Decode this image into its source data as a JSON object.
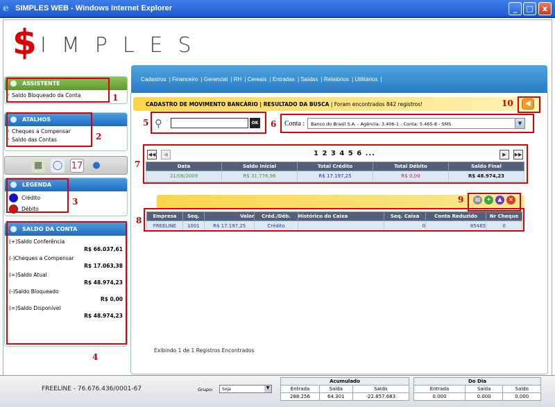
{
  "window": {
    "title": "SIMPLES WEB - Windows Internet Explorer",
    "min": "_",
    "max": "□",
    "close": "x"
  },
  "logo": {
    "dollar": "$",
    "rest": "IMPLES"
  },
  "menu": {
    "items": [
      "Cadastros",
      "Financeiro",
      "Gerencial",
      "RH",
      "Cereais",
      "Entradas",
      "Saídas",
      "Relatórios",
      "Utilitários"
    ]
  },
  "assistente": {
    "title": "ASSISTENTE",
    "items": [
      "Saldo Bloqueado da Conta"
    ]
  },
  "atalhos": {
    "title": "ATALHOS",
    "items": [
      "Cheques a Compensar",
      "Saldo das Contas"
    ]
  },
  "legenda": {
    "title": "LEGENDA",
    "items": [
      {
        "label": "Crédito",
        "color": "#0a10d8"
      },
      {
        "label": "Débito",
        "color": "#d81010"
      }
    ]
  },
  "saldo": {
    "title": "SALDO DA CONTA",
    "rows": [
      {
        "label": "(+)Saldo Conferência",
        "value": "R$ 66.037,61"
      },
      {
        "label": "(-)Cheques a Compensar",
        "value": "R$ 17.063,38"
      },
      {
        "label": "(=)Saldo Atual",
        "value": "R$ 48.974,23"
      },
      {
        "label": "(-)Saldo Bloqueado",
        "value": "R$ 0,00"
      },
      {
        "label": "(=)Saldo Disponível",
        "value": "R$ 48.974,23"
      }
    ]
  },
  "header": {
    "title": "CADASTRO DE MOVIMENTO BANCÁRIO | RESULTADO DA BUSCA",
    "subtitle": "| Foram encontrados 842 registros!"
  },
  "search": {
    "value": "",
    "ok_label": "OK"
  },
  "conta": {
    "label": "Conta :",
    "selected": "Banco do Brasil S.A. - Agência: 3.406-1 - Conta: 5.465-8 - SMS"
  },
  "pager": {
    "pages": "1 2 3 4 5 6 ...",
    "first": "◀◀",
    "prev": "◀",
    "next": "▶",
    "last": "▶▶"
  },
  "summary": {
    "headers": [
      "Data",
      "Saldo Inicial",
      "Total Crédito",
      "Total Débito",
      "Saldo Final"
    ],
    "row": [
      "21/08/2009",
      "R$ 31.776,96",
      "R$ 17.197,25",
      "R$ 0,00",
      "R$ 48.974,23"
    ]
  },
  "mov": {
    "headers": [
      "Empresa",
      "Seq.",
      "Valor",
      "Créd./Déb.",
      "Histórico do Caixa",
      "Seq. Caixa",
      "Conta Reduzido",
      "Nr Cheque"
    ],
    "rows": [
      [
        "FREELINE",
        "1001",
        "R$ 17.197,25",
        "Crédito",
        "",
        "0",
        "85465",
        "0"
      ]
    ]
  },
  "footer_note": "Exibindo 1 de 1 Registros Encontrados",
  "status": {
    "company": "FREELINE - 76.676.436/0001-67",
    "grupo_label": "Grupo:",
    "grupo_value": "Soja",
    "acumulado": {
      "title": "Acumulado",
      "headers": [
        "Entrada",
        "Saída",
        "Saldo"
      ],
      "values": [
        "288.256",
        "64.301",
        "-22.857.683"
      ]
    },
    "dodia": {
      "title": "Do Dia",
      "headers": [
        "Entrada",
        "Saída",
        "Saldo"
      ],
      "values": [
        "0.000",
        "0.000",
        "0.000"
      ]
    }
  },
  "annotations": [
    "1",
    "2",
    "3",
    "4",
    "5",
    "6",
    "7",
    "8",
    "9",
    "10"
  ]
}
